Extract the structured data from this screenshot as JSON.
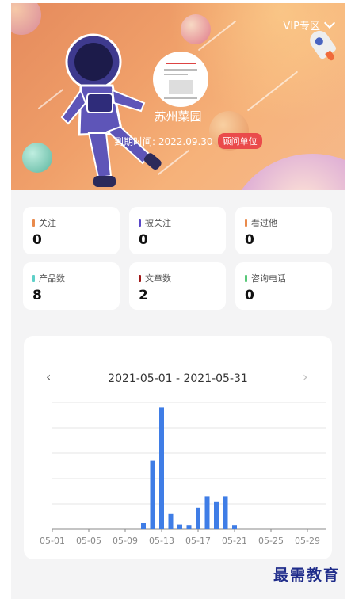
{
  "header": {
    "vip_label": "VIP专区",
    "company_name": "苏州菜园",
    "expire_text": "到期时间: 2022.09.30",
    "consultant_badge": "顾问单位"
  },
  "stats": [
    {
      "label": "关注",
      "value": "0",
      "color": "#e98a4c"
    },
    {
      "label": "被关注",
      "value": "0",
      "color": "#5a48c8"
    },
    {
      "label": "看过他",
      "value": "0",
      "color": "#e98a4c"
    },
    {
      "label": "产品数",
      "value": "8",
      "color": "#5fd0c8"
    },
    {
      "label": "文章数",
      "value": "2",
      "color": "#a01818"
    },
    {
      "label": "咨询电话",
      "value": "0",
      "color": "#58c878"
    }
  ],
  "chart": {
    "range_label": "2021-05-01 - 2021-05-31",
    "prev_symbol": "‹",
    "next_symbol": "›"
  },
  "chart_data": {
    "type": "bar",
    "categories": [
      "05-01",
      "05-02",
      "05-03",
      "05-04",
      "05-05",
      "05-06",
      "05-07",
      "05-08",
      "05-09",
      "05-10",
      "05-11",
      "05-12",
      "05-13",
      "05-14",
      "05-15",
      "05-16",
      "05-17",
      "05-18",
      "05-19",
      "05-20",
      "05-21",
      "05-22",
      "05-23",
      "05-24",
      "05-25",
      "05-26",
      "05-27",
      "05-28",
      "05-29",
      "05-30",
      "05-31"
    ],
    "tick_labels": [
      "05-01",
      "05-05",
      "05-09",
      "05-13",
      "05-17",
      "05-21",
      "05-25",
      "05-29"
    ],
    "values": [
      0,
      0,
      0,
      0,
      0,
      0,
      0,
      0,
      0,
      0,
      0.5,
      5.4,
      9.6,
      1.2,
      0.4,
      0.3,
      1.7,
      2.6,
      2.2,
      2.6,
      0.3,
      0,
      0,
      0,
      0,
      0,
      0,
      0,
      0,
      0,
      0
    ],
    "ylim": [
      0,
      10
    ],
    "grid": true,
    "bar_color": "#3f7de6"
  },
  "watermark": "最需教育"
}
